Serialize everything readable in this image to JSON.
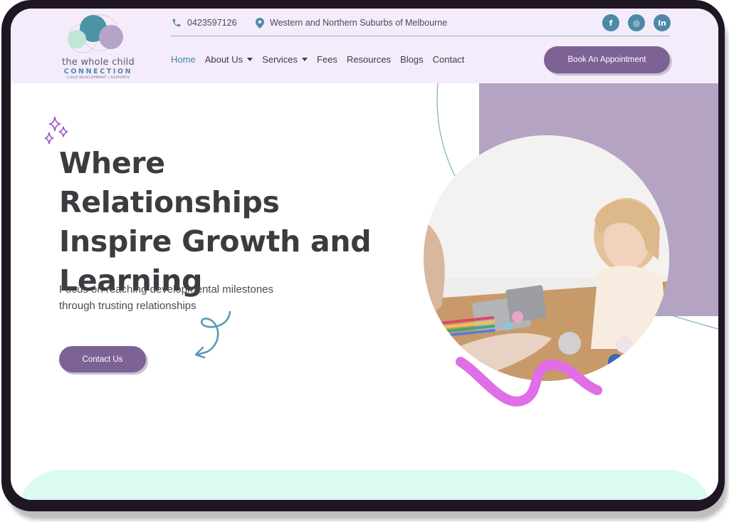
{
  "header": {
    "phone": "0423597126",
    "location": "Western and Northern Suburbs of Melbourne",
    "logo": {
      "line1": "the whole child",
      "line2": "CONNECTION",
      "line3": "CHILD DEVELOPMENT • SUPPORTS"
    },
    "socials": [
      {
        "name": "facebook",
        "glyph": "f"
      },
      {
        "name": "instagram",
        "glyph": "◎"
      },
      {
        "name": "linkedin",
        "glyph": "in"
      }
    ],
    "nav": [
      {
        "label": "Home",
        "active": true,
        "dropdown": false
      },
      {
        "label": "About Us",
        "active": false,
        "dropdown": true
      },
      {
        "label": "Services",
        "active": false,
        "dropdown": true
      },
      {
        "label": "Fees",
        "active": false,
        "dropdown": false
      },
      {
        "label": "Resources",
        "active": false,
        "dropdown": false
      },
      {
        "label": "Blogs",
        "active": false,
        "dropdown": false
      },
      {
        "label": "Contact",
        "active": false,
        "dropdown": false
      }
    ],
    "cta_label": "Book An Appointment"
  },
  "hero": {
    "title_line1": "Where Relationships",
    "title_highlight": "Inspire Growth",
    "title_rest2": " and",
    "title_line3": "Learning",
    "subtitle_line1": "Focus on reaching developmental milestones",
    "subtitle_line2": "through trusting relationships",
    "cta_label": "Contact Us"
  },
  "colors": {
    "header_bg": "#f5ecfb",
    "brand_purple": "#7d6295",
    "accent_blue": "#4d8aa7",
    "lilac_block": "#b5a3c4",
    "pink_accent": "#e06ee6",
    "mint": "#dbfaf1",
    "highlight": "#b7e4d9"
  }
}
